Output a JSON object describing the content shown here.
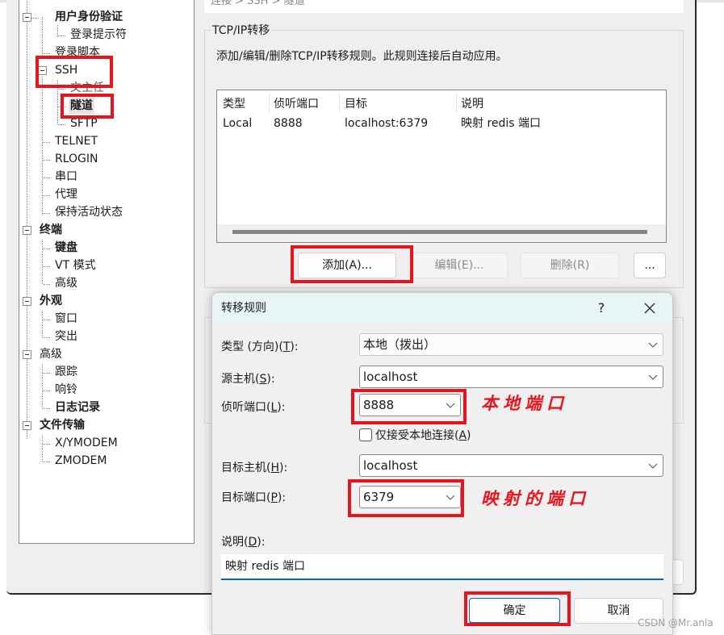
{
  "breadcrumb": "连接 > SSH > 隧道",
  "tree": {
    "items": [
      {
        "label": "用户身份验证",
        "bold": true
      },
      {
        "label": "登录提示符"
      },
      {
        "label": "登录脚本"
      },
      {
        "label": "SSH"
      },
      {
        "label": "文主任"
      },
      {
        "label": "隧道",
        "selected": true
      },
      {
        "label": "SFTP"
      },
      {
        "label": "TELNET"
      },
      {
        "label": "RLOGIN"
      },
      {
        "label": "串口"
      },
      {
        "label": "代理"
      },
      {
        "label": "保持活动状态"
      },
      {
        "label": "终端",
        "bold": true
      },
      {
        "label": "键盘",
        "bold": true
      },
      {
        "label": "VT 模式"
      },
      {
        "label": "高级"
      },
      {
        "label": "外观",
        "bold": true
      },
      {
        "label": "窗口"
      },
      {
        "label": "突出"
      },
      {
        "label": "高级"
      },
      {
        "label": "跟踪"
      },
      {
        "label": "响铃"
      },
      {
        "label": "日志记录",
        "bold": true
      },
      {
        "label": "文件传输",
        "bold": true
      },
      {
        "label": "X/YMODEM"
      },
      {
        "label": "ZMODEM"
      }
    ]
  },
  "forwarding": {
    "group_title": "TCP/IP转移",
    "description": "添加/编辑/删除TCP/IP转移规则。此规则连接后自动应用。",
    "columns": [
      "类型",
      "侦听端口",
      "目标",
      "说明"
    ],
    "rows": [
      [
        "Local",
        "8888",
        "localhost:6379",
        "映射 redis 端口"
      ]
    ],
    "buttons": {
      "add": "添加(A)...",
      "edit": "编辑(E)...",
      "delete": "删除(R)",
      "more": "..."
    }
  },
  "dialog": {
    "title": "转移规则",
    "help": "?",
    "fields": {
      "type_label": "类型 (方向)(",
      "type_key": "T",
      "type_value": "本地（拨出）",
      "source_host_label": "源主机(",
      "source_host_key": "S",
      "source_host_value": "localhost",
      "listen_port_label": "侦听端口(",
      "listen_port_key": "L",
      "listen_port_value": "8888",
      "local_only_label": "仅接受本地连接(",
      "local_only_key": "A",
      "local_only_checked": false,
      "target_host_label": "目标主机(",
      "target_host_key": "H",
      "target_host_value": "localhost",
      "target_port_label": "目标端口(",
      "target_port_key": "P",
      "target_port_value": "6379",
      "description_label": "说明(",
      "description_key": "D",
      "description_value": "映射 redis 端口"
    },
    "ok": "确定",
    "cancel": "取消"
  },
  "annotations": {
    "local_port": "本地端口",
    "mapped_port": "映射的端口",
    "color": "#e8141c"
  },
  "watermark": "CSDN @Mr.anla"
}
